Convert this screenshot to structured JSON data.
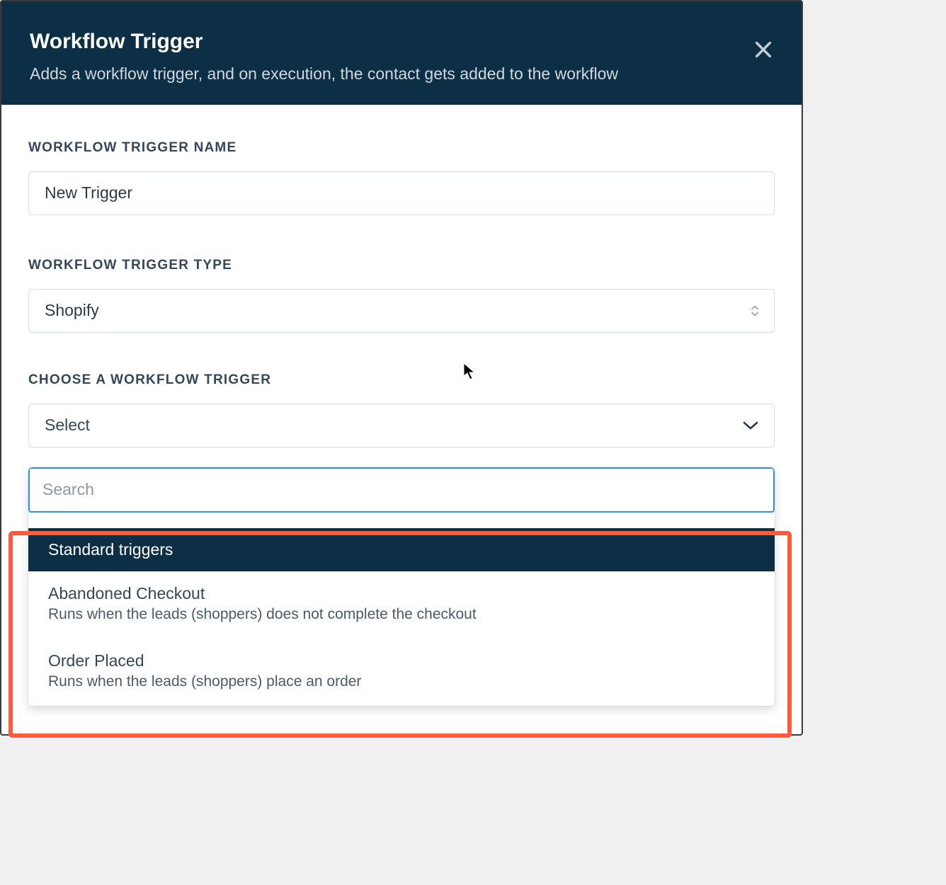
{
  "header": {
    "title": "Workflow Trigger",
    "subtitle": "Adds a workflow trigger, and on execution, the contact gets added to the workflow"
  },
  "fields": {
    "name_label": "WORKFLOW TRIGGER NAME",
    "name_value": "New Trigger",
    "type_label": "WORKFLOW TRIGGER TYPE",
    "type_value": "Shopify",
    "choose_label": "CHOOSE A WORKFLOW TRIGGER",
    "choose_placeholder": "Select"
  },
  "dropdown": {
    "search_placeholder": "Search",
    "group_header": "Standard triggers",
    "options": [
      {
        "title": "Abandoned Checkout",
        "desc": "Runs when the leads (shoppers) does not complete the checkout"
      },
      {
        "title": "Order Placed",
        "desc": "Runs when the leads (shoppers) place an order"
      }
    ]
  }
}
